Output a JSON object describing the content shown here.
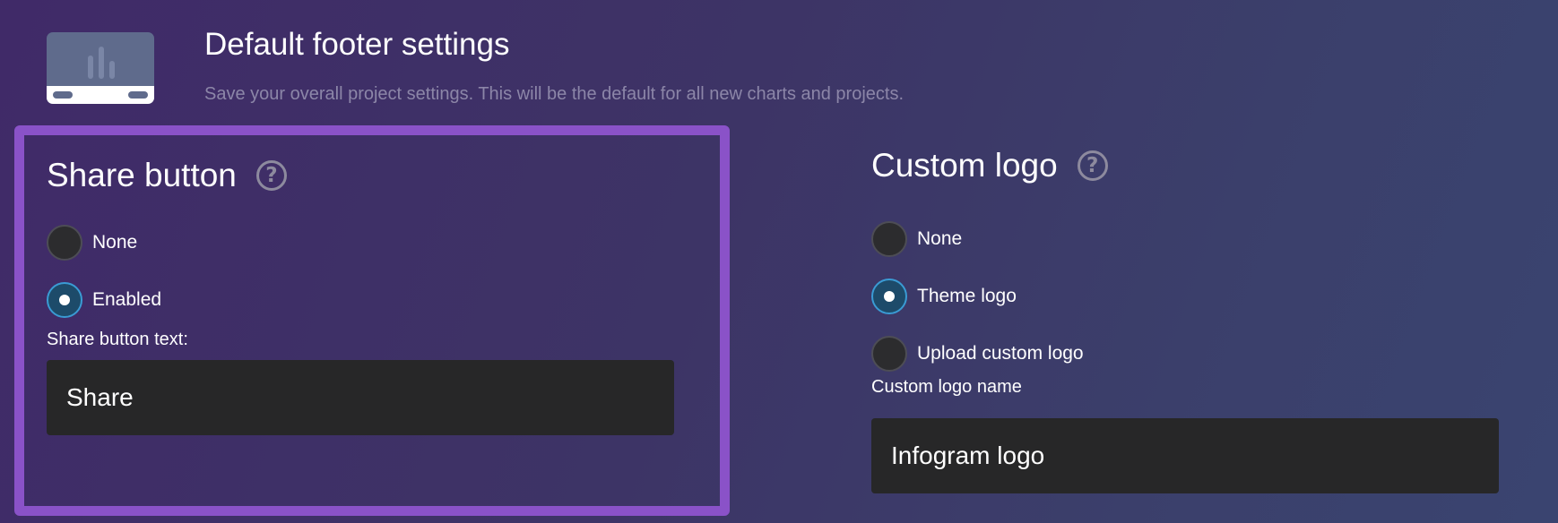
{
  "header": {
    "title": "Default footer settings",
    "subtitle": "Save your overall project settings. This will be the default for all new charts and projects.",
    "icon": "footer-chart-icon"
  },
  "share_section": {
    "heading": "Share button",
    "help_icon": "help-icon",
    "options": [
      {
        "label": "None",
        "selected": false
      },
      {
        "label": "Enabled",
        "selected": true
      }
    ],
    "text_label": "Share button text:",
    "text_value": "Share"
  },
  "logo_section": {
    "heading": "Custom logo",
    "help_icon": "help-icon",
    "options": [
      {
        "label": "None",
        "selected": false
      },
      {
        "label": "Theme logo",
        "selected": true
      },
      {
        "label": "Upload custom logo",
        "selected": false
      }
    ],
    "name_label": "Custom logo name",
    "name_value": "Infogram logo"
  },
  "colors": {
    "highlight_border": "#8a52c8",
    "radio_selected": "#3a9bd4",
    "input_background": "#272728"
  }
}
